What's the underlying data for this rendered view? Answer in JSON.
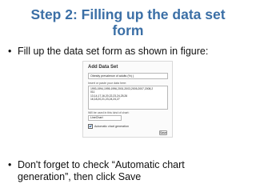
{
  "slide": {
    "title_line1": "Step 2: Filling up the data set",
    "title_line2": "form",
    "bullet1": "Fill up the data set form as shown in figure:",
    "bullet2_line1": "Don't forget to check “Automatic chart",
    "bullet2_line2": "generation”, then click Save",
    "bullet_glyph": "•"
  },
  "form": {
    "heading": "Add Data Set",
    "name_value": "Obesity prevalence of adults (%) (",
    "data_label": "Insert or paste your data here:",
    "data_lines": [
      "1993,1994,1995,1996,2001,2003,2005,2007,2008,2",
      "011",
      "13,14,17,16,20,22,23,24,25,26",
      "16,18,20,21,23,24,24,27"
    ],
    "field_label": "Will be used in this kind of chart:",
    "field_value": "LineChart",
    "checkbox_label": "Automatic chart generation",
    "checkbox_checked": true,
    "save_label": "Save"
  }
}
